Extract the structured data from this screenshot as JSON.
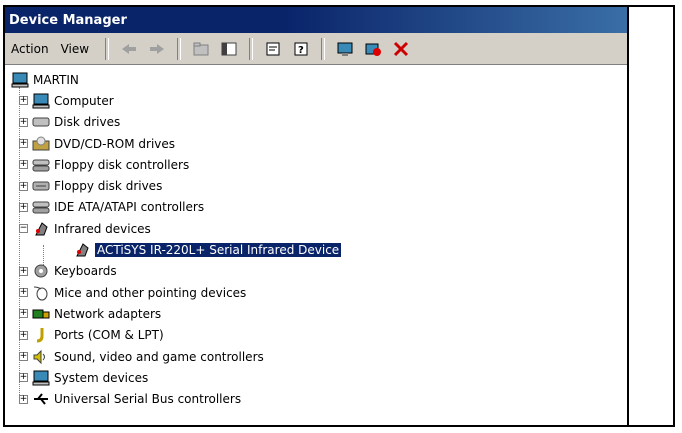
{
  "window": {
    "title": "Device Manager"
  },
  "menu": {
    "action": "Action",
    "view": "View"
  },
  "toolbar": {
    "icons": [
      "back-arrow-icon",
      "forward-arrow-icon",
      "up-folder-icon",
      "show-hide-tree-icon",
      "properties-icon",
      "help-icon",
      "scan-hardware-icon",
      "disable-device-icon",
      "uninstall-device-icon"
    ]
  },
  "tree": {
    "root": "MARTIN",
    "categories": [
      {
        "label": "Computer",
        "icon": "computer-icon"
      },
      {
        "label": "Disk drives",
        "icon": "disk-drive-icon"
      },
      {
        "label": "DVD/CD-ROM drives",
        "icon": "cdrom-icon"
      },
      {
        "label": "Floppy disk controllers",
        "icon": "controller-icon"
      },
      {
        "label": "Floppy disk drives",
        "icon": "floppy-drive-icon"
      },
      {
        "label": "IDE ATA/ATAPI controllers",
        "icon": "ide-controller-icon"
      },
      {
        "label": "Infrared devices",
        "icon": "infrared-icon",
        "expanded": true,
        "children": [
          {
            "label": "ACTiSYS IR-220L+ Serial Infrared Device",
            "icon": "infrared-device-icon",
            "selected": true
          }
        ]
      },
      {
        "label": "Keyboards",
        "icon": "keyboard-icon"
      },
      {
        "label": "Mice and other pointing devices",
        "icon": "mouse-icon"
      },
      {
        "label": "Network adapters",
        "icon": "network-adapter-icon"
      },
      {
        "label": "Ports (COM & LPT)",
        "icon": "port-icon"
      },
      {
        "label": "Sound, video and game controllers",
        "icon": "sound-icon"
      },
      {
        "label": "System devices",
        "icon": "system-device-icon"
      },
      {
        "label": "Universal Serial Bus controllers",
        "icon": "usb-icon"
      }
    ]
  },
  "colors": {
    "titlebar": "#0a246a",
    "toolbar_bg": "#d4d0c8",
    "selection": "#0a246a"
  }
}
